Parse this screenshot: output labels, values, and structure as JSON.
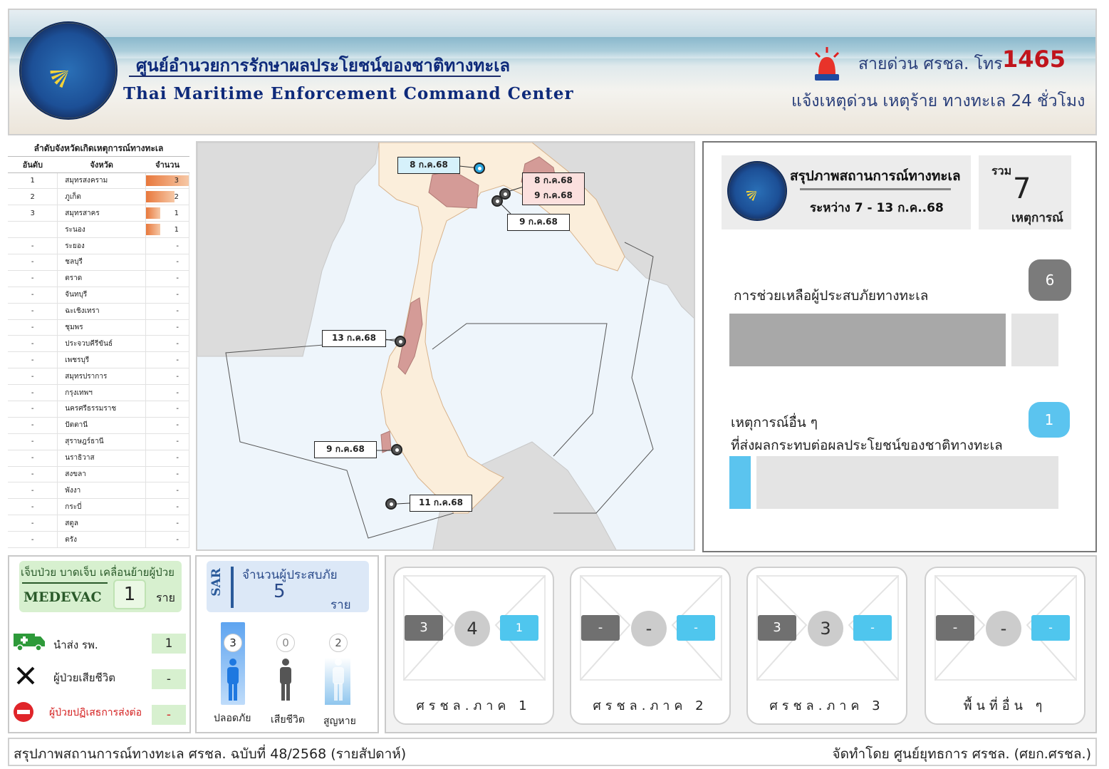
{
  "header": {
    "title_th": "ศูนย์อำนวยการรักษาผลประโยชน์ของชาติทางทะเล",
    "title_en": "Thai Maritime Enforcement Command Center",
    "hotline_label": "สายด่วน ศรชล. โทร",
    "hotline_number": "1465",
    "hotline_sub": "แจ้งเหตุด่วน เหตุร้าย ทางทะเล 24 ชั่วโมง",
    "siren_icon": "siren-icon"
  },
  "ranking": {
    "title": "ลำดับจังหวัดเกิดเหตุการณ์ทางทะเล",
    "columns": [
      "อันดับ",
      "จังหวัด",
      "จำนวน"
    ],
    "max": 3,
    "rows": [
      {
        "rank": "1",
        "province": "สมุทรสงคราม",
        "count": "3",
        "value": 3
      },
      {
        "rank": "2",
        "province": "ภูเก็ต",
        "count": "2",
        "value": 2
      },
      {
        "rank": "3",
        "province": "สมุทรสาคร",
        "count": "1",
        "value": 1
      },
      {
        "rank": "",
        "province": "ระนอง",
        "count": "1",
        "value": 1
      },
      {
        "rank": "-",
        "province": "ระยอง",
        "count": "-",
        "value": 0
      },
      {
        "rank": "-",
        "province": "ชลบุรี",
        "count": "-",
        "value": 0
      },
      {
        "rank": "-",
        "province": "ตราด",
        "count": "-",
        "value": 0
      },
      {
        "rank": "-",
        "province": "จันทบุรี",
        "count": "-",
        "value": 0
      },
      {
        "rank": "-",
        "province": "ฉะเชิงเทรา",
        "count": "-",
        "value": 0
      },
      {
        "rank": "-",
        "province": "ชุมพร",
        "count": "-",
        "value": 0
      },
      {
        "rank": "-",
        "province": "ประจวบคีรีขันธ์",
        "count": "-",
        "value": 0
      },
      {
        "rank": "-",
        "province": "เพชรบุรี",
        "count": "-",
        "value": 0
      },
      {
        "rank": "-",
        "province": "สมุทรปราการ",
        "count": "-",
        "value": 0
      },
      {
        "rank": "-",
        "province": "กรุงเทพฯ",
        "count": "-",
        "value": 0
      },
      {
        "rank": "-",
        "province": "นครศรีธรรมราช",
        "count": "-",
        "value": 0
      },
      {
        "rank": "-",
        "province": "ปัตตานี",
        "count": "-",
        "value": 0
      },
      {
        "rank": "-",
        "province": "สุราษฎร์ธานี",
        "count": "-",
        "value": 0
      },
      {
        "rank": "-",
        "province": "นราธิวาส",
        "count": "-",
        "value": 0
      },
      {
        "rank": "-",
        "province": "สงขลา",
        "count": "-",
        "value": 0
      },
      {
        "rank": "-",
        "province": "พังงา",
        "count": "-",
        "value": 0
      },
      {
        "rank": "-",
        "province": "กระบี่",
        "count": "-",
        "value": 0
      },
      {
        "rank": "-",
        "province": "สตูล",
        "count": "-",
        "value": 0
      },
      {
        "rank": "-",
        "province": "ตรัง",
        "count": "-",
        "value": 0
      }
    ]
  },
  "map": {
    "labels": [
      "8 ก.ค.68",
      "8 ก.ค.68",
      "9 ก.ค.68",
      "9 ก.ค.68",
      "13 ก.ค.68",
      "9 ก.ค.68",
      "11 ก.ค.68"
    ],
    "colors": {
      "sea": "#eef5fb",
      "land": "#fbeedb",
      "highlight": "#d49b97",
      "neighbor": "#dcdcdc"
    }
  },
  "summary": {
    "title": "สรุปภาพสถานการณ์ทางทะเล",
    "period": "ระหว่าง 7 - 13 ก.ค..68",
    "total_label": "รวม",
    "total": "7",
    "total_unit": "เหตุการณ์",
    "rescue_label": "การช่วยเหลือผู้ประสบภัยทางทะเล",
    "rescue_count": "6",
    "rescue_share": 0.857,
    "other_label_1": "เหตุการณ์อื่น ๆ",
    "other_label_2": "ที่ส่งผลกระทบต่อผลประโยชน์ของชาติทางทะเล",
    "other_count": "1",
    "other_share": 0.143,
    "colors": {
      "rescue": "#a8a8a8",
      "other": "#5bc4ef",
      "remainder": "#e4e4e4"
    }
  },
  "medevac": {
    "heading": "เจ็บป่วย บาดเจ็บ เคลื่อนย้ายผู้ป่วย",
    "label": "MEDEVAC",
    "count": "1",
    "unit": "ราย",
    "rows": [
      {
        "icon": "ambulance-icon",
        "label": "นำส่ง รพ.",
        "value": "1"
      },
      {
        "icon": "cross-icon",
        "label": "ผู้ป่วยเสียชีวิต",
        "value": "-"
      },
      {
        "icon": "no-entry-icon",
        "label": "ผู้ป่วยปฏิเสธการส่งต่อ",
        "value": "-"
      }
    ]
  },
  "sar": {
    "tag": "SAR",
    "heading": "จำนวนผู้ประสบภัย",
    "count": "5",
    "unit": "ราย",
    "people": [
      {
        "label": "ปลอดภัย",
        "value": "3",
        "icon": "person-safe-icon"
      },
      {
        "label": "เสียชีวิต",
        "value": "0",
        "icon": "person-dead-icon"
      },
      {
        "label": "สูญหาย",
        "value": "2",
        "icon": "person-missing-icon"
      }
    ]
  },
  "regions": [
    {
      "label": "ศรชล.ภาค 1",
      "left": "3",
      "mid": "4",
      "right": "1"
    },
    {
      "label": "ศรชล.ภาค 2",
      "left": "-",
      "mid": "-",
      "right": "-"
    },
    {
      "label": "ศรชล.ภาค 3",
      "left": "3",
      "mid": "3",
      "right": "-"
    },
    {
      "label": "พื้นที่อื่น ๆ",
      "left": "-",
      "mid": "-",
      "right": "-"
    }
  ],
  "footer": {
    "left": "สรุปภาพสถานการณ์ทางทะเล ศรชล. ฉบับที่ 48/2568 (รายสัปดาห์)",
    "right": "จัดทำโดย ศูนย์ยุทธการ ศรชล. (ศยก.ศรชล.)"
  }
}
